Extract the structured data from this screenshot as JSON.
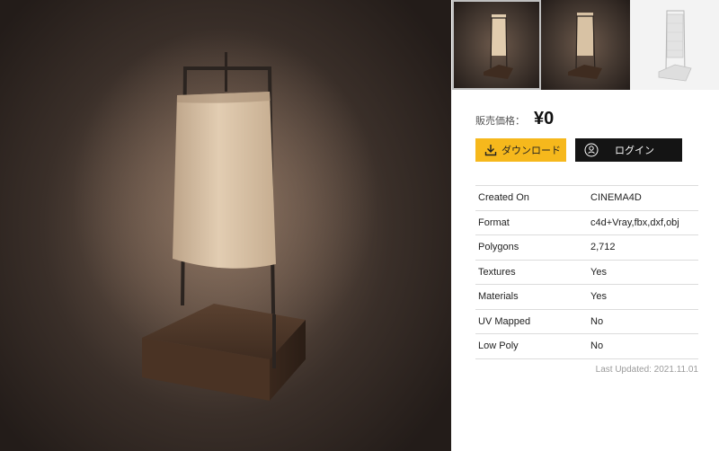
{
  "gallery": {
    "thumbnails": [
      {
        "name": "thumbnail-1",
        "style": "dark",
        "active": true
      },
      {
        "name": "thumbnail-2",
        "style": "dark",
        "active": false
      },
      {
        "name": "thumbnail-3",
        "style": "light",
        "active": false
      }
    ]
  },
  "price": {
    "label": "販売価格：",
    "value": "¥0"
  },
  "buttons": {
    "download_label": "ダウンロード",
    "download_icon": "download-icon",
    "login_label": "ログイン",
    "login_icon": "user-badge-icon",
    "download_color": "#f6b81c",
    "login_color": "#141414"
  },
  "specs": [
    {
      "key": "Created On",
      "value": "CINEMA4D"
    },
    {
      "key": "Format",
      "value": "c4d+Vray,fbx,dxf,obj"
    },
    {
      "key": "Polygons",
      "value": "2,712"
    },
    {
      "key": "Textures",
      "value": "Yes"
    },
    {
      "key": "Materials",
      "value": "Yes"
    },
    {
      "key": "UV Mapped",
      "value": "No"
    },
    {
      "key": "Low Poly",
      "value": "No"
    }
  ],
  "last_updated": "Last Updated: 2021.11.01"
}
